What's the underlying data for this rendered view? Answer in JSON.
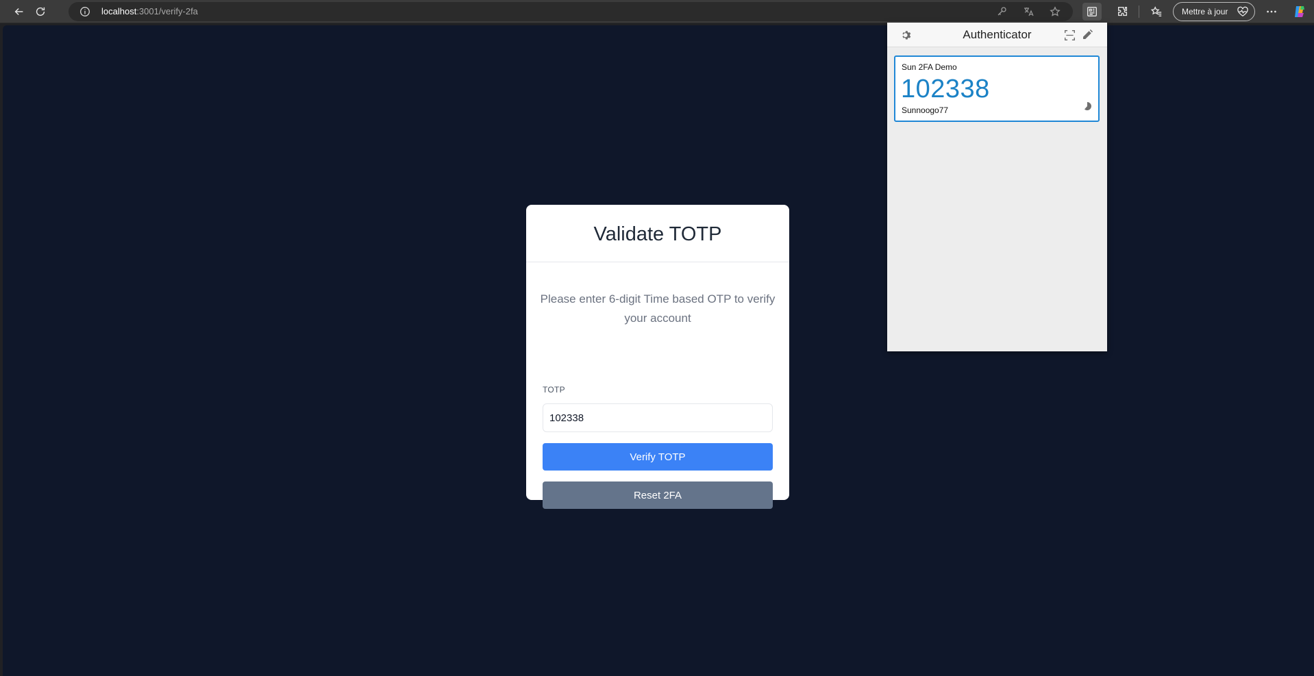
{
  "browser": {
    "url_host": "localhost",
    "url_path": ":3001/verify-2fa",
    "update_button_label": "Mettre à jour",
    "icons": [
      "back-icon",
      "refresh-icon",
      "info-icon",
      "key-icon",
      "translate-icon",
      "favorite-star-icon",
      "authenticator-extension-icon",
      "extensions-icon",
      "favorites-icon",
      "heart-pulse-icon",
      "more-icon",
      "copilot-icon"
    ]
  },
  "page": {
    "title": "Validate TOTP",
    "description": "Please enter 6-digit Time based OTP to verify your account",
    "field_label": "TOTP",
    "otp_value": "102338",
    "verify_label": "Verify TOTP",
    "reset_label": "Reset 2FA",
    "colors": {
      "background": "#0f172a",
      "verify_button": "#3b82f6",
      "reset_button": "#64748b"
    }
  },
  "authenticator": {
    "title": "Authenticator",
    "entry": {
      "issuer": "Sun 2FA Demo",
      "code": "102338",
      "account": "Sunnoogo77"
    },
    "colors": {
      "code": "#1b82c6",
      "border": "#1f87d6"
    }
  }
}
